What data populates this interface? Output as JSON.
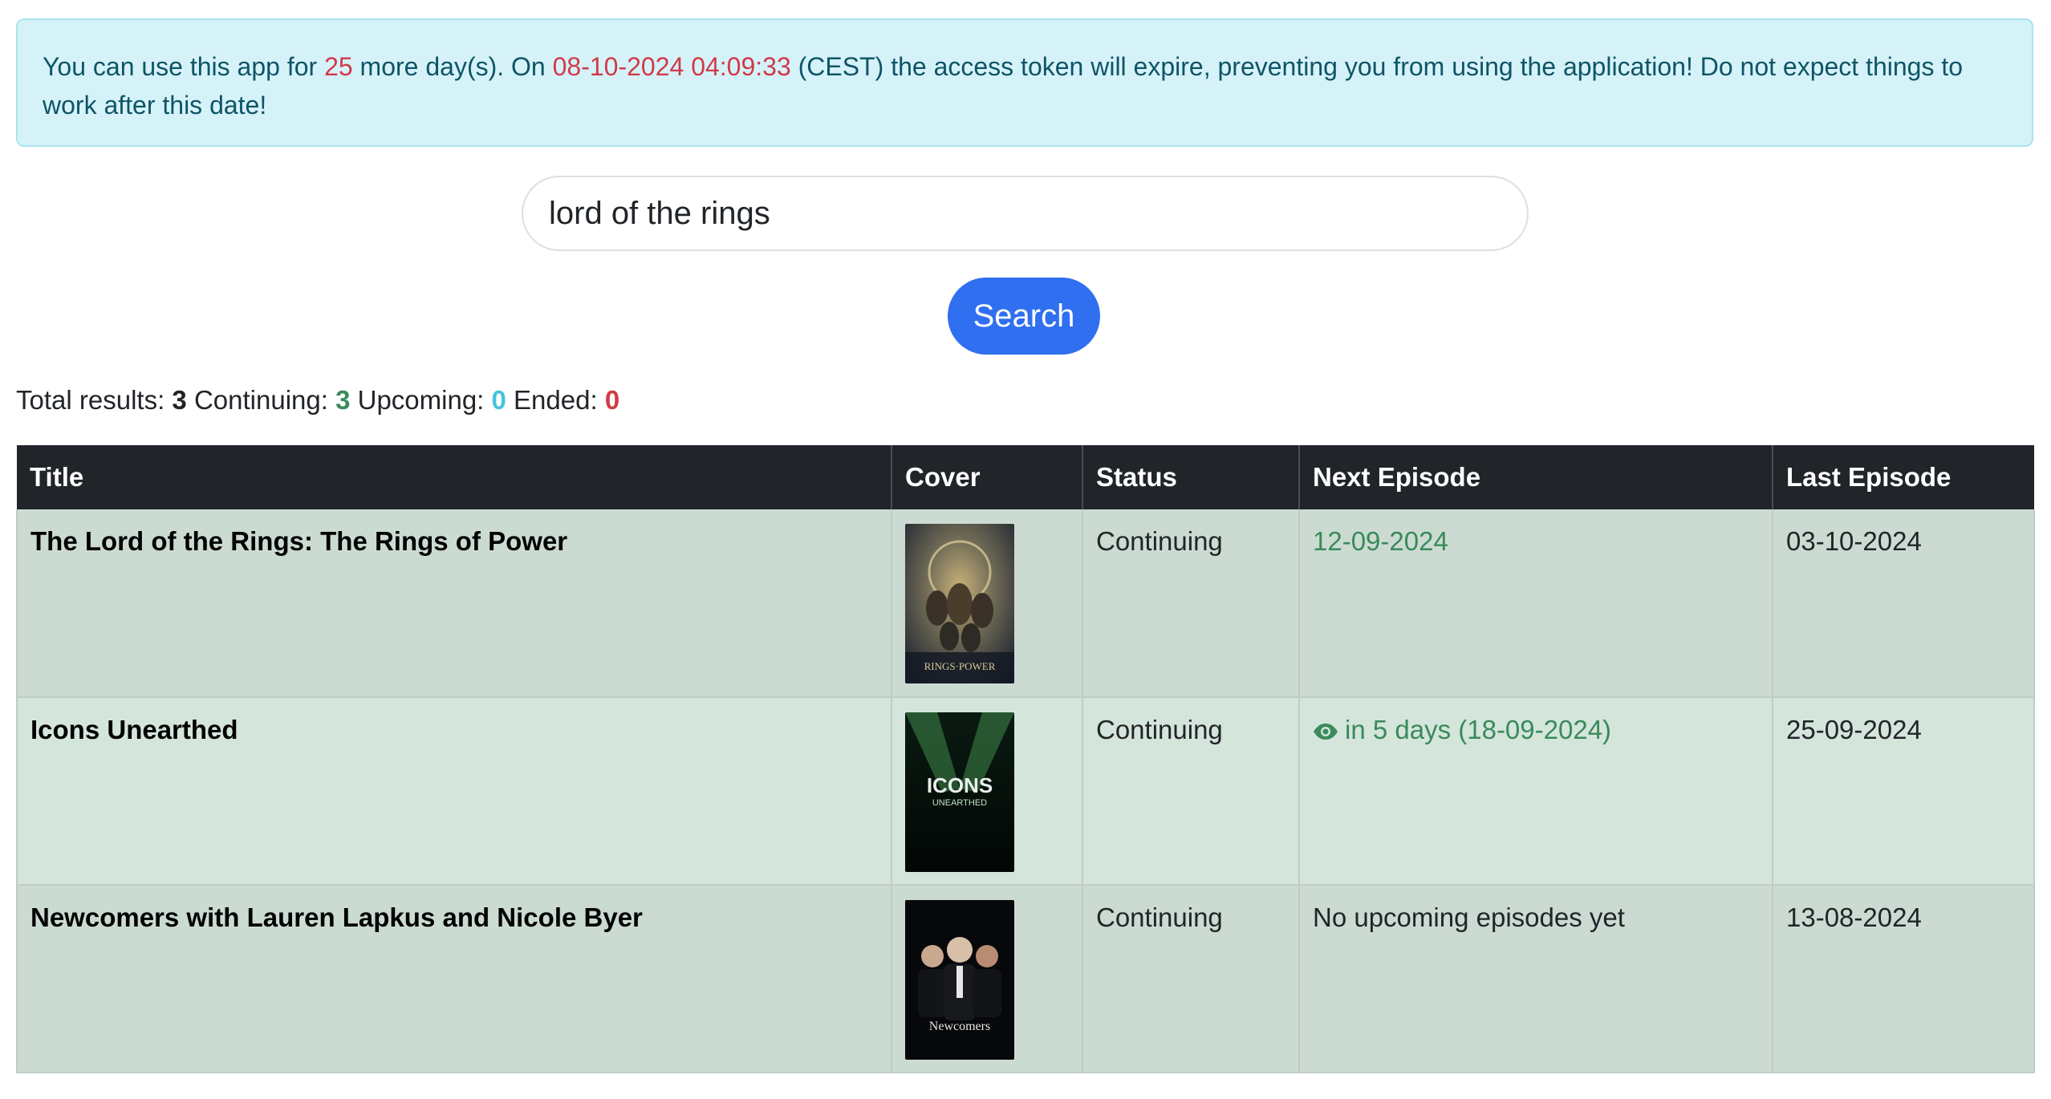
{
  "alert": {
    "part1": "You can use this app for ",
    "days": "25",
    "part2": " more day(s). On ",
    "expiry": "08-10-2024 04:09:33",
    "part3": " (CEST) the access token will expire, preventing you from using the application! Do not expect things to work after this date!"
  },
  "search": {
    "value": "lord of the rings",
    "button_label": "Search"
  },
  "totals": {
    "total_label": "Total results: ",
    "total": "3",
    "continuing_label": " Continuing: ",
    "continuing": "3",
    "upcoming_label": " Upcoming: ",
    "upcoming": "0",
    "ended_label": " Ended: ",
    "ended": "0"
  },
  "table": {
    "headers": {
      "title": "Title",
      "cover": "Cover",
      "status": "Status",
      "next": "Next Episode",
      "last": "Last Episode"
    },
    "rows": [
      {
        "title": "The Lord of the Rings: The Rings of Power",
        "cover_text": "RINGS·POWER",
        "status": "Continuing",
        "next": "12-09-2024",
        "last": "03-10-2024"
      },
      {
        "title": "Icons Unearthed",
        "cover_text_1": "ICONS",
        "cover_text_2": "UNEARTHED",
        "status": "Continuing",
        "next": "in 5 days (18-09-2024)",
        "last": "25-09-2024"
      },
      {
        "title": "Newcomers with Lauren Lapkus and Nicole Byer",
        "cover_text": "Newcomers",
        "status": "Continuing",
        "next": "No upcoming episodes yet",
        "last": "13-08-2024"
      }
    ]
  },
  "colors": {
    "alert_bg": "#d6f2f9",
    "highlight_red": "#d13a48",
    "success_green": "#3a8a5a",
    "info_cyan": "#45c3e0",
    "primary_blue": "#2f6ff0",
    "table_header_bg": "#212529"
  },
  "icons": {
    "next_episode_soon": "eye-icon"
  }
}
